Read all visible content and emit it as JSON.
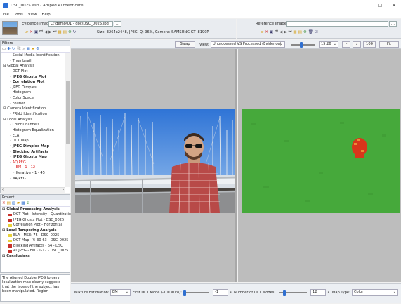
{
  "window": {
    "title": "DSC_0025.asp - Amped Authenticate",
    "minimize": "–",
    "maximize": "☐",
    "close": "✕"
  },
  "menu": [
    "File",
    "Tools",
    "View",
    "Help"
  ],
  "evidence": {
    "label": "Evidence Image:",
    "path": "C:\\demo\\01 - doc\\DSC_0025.jpg",
    "info": "Size: 3264x2448, JPEG, Q: 96%, Camera: SAMSUNG GT-I8190P"
  },
  "reference": {
    "label": "Reference Image:",
    "path": ""
  },
  "filters": {
    "header": "Filters",
    "items": [
      {
        "text": "Social Media Identification",
        "indent": 2,
        "style": "normal"
      },
      {
        "text": "Thumbnail",
        "indent": 2,
        "style": "normal"
      },
      {
        "text": "Global Analysis",
        "indent": 0,
        "style": "normal",
        "expander": "⊟"
      },
      {
        "text": "DCT Plot",
        "indent": 2,
        "style": "normal"
      },
      {
        "text": "JPEG Ghosts Plot",
        "indent": 2,
        "style": "bold"
      },
      {
        "text": "Correlation Plot",
        "indent": 2,
        "style": "bold"
      },
      {
        "text": "JPEG Dimples",
        "indent": 2,
        "style": "normal"
      },
      {
        "text": "Histogram",
        "indent": 2,
        "style": "normal"
      },
      {
        "text": "Color Space",
        "indent": 2,
        "style": "normal"
      },
      {
        "text": "Fourier",
        "indent": 2,
        "style": "normal"
      },
      {
        "text": "Camera Identification",
        "indent": 0,
        "style": "normal",
        "expander": "⊟"
      },
      {
        "text": "PRNU Identification",
        "indent": 2,
        "style": "normal"
      },
      {
        "text": "Local Analysis",
        "indent": 0,
        "style": "normal",
        "expander": "⊟"
      },
      {
        "text": "Color Channels",
        "indent": 2,
        "style": "normal"
      },
      {
        "text": "Histogram Equalization",
        "indent": 2,
        "style": "normal"
      },
      {
        "text": "ELA",
        "indent": 2,
        "style": "normal"
      },
      {
        "text": "DCT Map",
        "indent": 2,
        "style": "normal"
      },
      {
        "text": "JPEG Dimples Map",
        "indent": 2,
        "style": "bold"
      },
      {
        "text": "Blocking Artifacts",
        "indent": 2,
        "style": "bold"
      },
      {
        "text": "JPEG Ghosts Map",
        "indent": 2,
        "style": "bold"
      },
      {
        "text": "ADJPEG",
        "indent": 2,
        "style": "red"
      },
      {
        "text": "EM - 1 - 12",
        "indent": 3,
        "style": "red"
      },
      {
        "text": "Iterative - 1 - 45",
        "indent": 3,
        "style": "normal"
      },
      {
        "text": "NAJPEG",
        "indent": 2,
        "style": "normal"
      }
    ]
  },
  "project": {
    "header": "Project",
    "items": [
      {
        "text": "Global Processing Analysis",
        "swatch": "",
        "style": "bold",
        "expander": "⊟"
      },
      {
        "text": "DCT Plot - Intensity - Quantization",
        "swatch": "#c8312b",
        "style": "normal"
      },
      {
        "text": "JPEG Ghosts Plot - DSC_0025",
        "swatch": "#c8312b",
        "style": "normal"
      },
      {
        "text": "Correlation Plot - Horizontal",
        "swatch": "#e8d23a",
        "style": "normal"
      },
      {
        "text": "Local Tampering Analysis",
        "swatch": "",
        "style": "bold",
        "expander": "⊟"
      },
      {
        "text": "ELA - MSE: 75 - DSC_0025",
        "swatch": "#e8d23a",
        "style": "normal"
      },
      {
        "text": "DCT Map - Y: 30-63 - DSC_0025",
        "swatch": "#e8d23a",
        "style": "normal"
      },
      {
        "text": "Blocking Artifacts - 64 - DSC",
        "swatch": "#c8312b",
        "style": "normal"
      },
      {
        "text": "ADJPEG - EM - 1-12 - DSC_0025",
        "swatch": "#c8312b",
        "style": "normal"
      },
      {
        "text": "Conclusions",
        "swatch": "",
        "style": "bold",
        "expander": "⊞"
      }
    ]
  },
  "conclusion": {
    "text": "The Aligned Double JPEG forgery localization map clearly suggests that the faces of the subject has been manipulated. Region"
  },
  "viewer": {
    "swap": "Swap",
    "view_label": "View:",
    "view_value": "Unprocessed VS Processed (Evidence)",
    "zoom_value": "15.26",
    "zoom_minus": "–",
    "zoom_100": "100",
    "fit": "Fit"
  },
  "params": {
    "mixture_label": "Mixture Estimation:",
    "mixture_value": "EM",
    "first_dct_label": "First DCT Mode (-1 = auto):",
    "first_dct_value": "-1",
    "num_dct_label": "Number of DCT Modes:",
    "num_dct_value": "12",
    "map_type_label": "Map Type:",
    "map_type_value": "Color"
  },
  "colors": {
    "accent": "#2f6fd0",
    "heatmap_green": "#46a93b",
    "heatmap_red": "#d8361b"
  }
}
